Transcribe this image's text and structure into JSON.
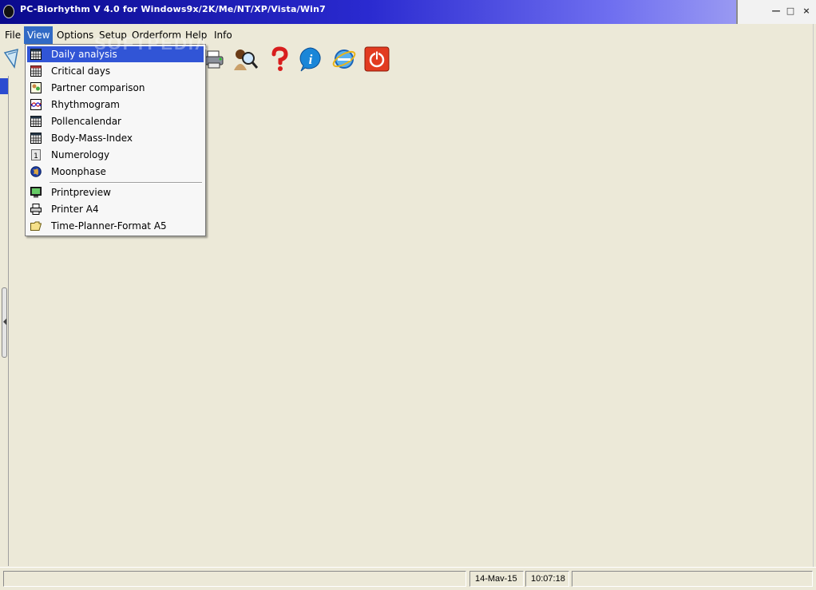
{
  "window": {
    "title": "PC-Biorhythm V 4.0 for Windows9x/2K/Me/NT/XP/Vista/Win7",
    "minimize_glyph": "□",
    "maximize_glyph": "▣",
    "close_glyph": "×"
  },
  "menubar": {
    "items": [
      {
        "label": "File"
      },
      {
        "label": "View"
      },
      {
        "label": "Options"
      },
      {
        "label": "Setup"
      },
      {
        "label": "Orderform"
      },
      {
        "label": "Help"
      },
      {
        "label": "Info"
      }
    ],
    "active": "View"
  },
  "toolbar": {
    "icons": [
      "pen-icon",
      "printer-icon",
      "search-person-icon",
      "help-icon",
      "info-icon",
      "internet-explorer-icon",
      "power-icon"
    ]
  },
  "view_menu": {
    "items": [
      {
        "label": "Daily analysis",
        "icon": "calendar-grid-icon",
        "highlighted": true
      },
      {
        "label": "Critical days",
        "icon": "calendar-grid-icon"
      },
      {
        "label": "Partner comparison",
        "icon": "partner-icon"
      },
      {
        "label": "Rhythmogram",
        "icon": "chart-icon"
      },
      {
        "label": "Pollencalendar",
        "icon": "calendar-grid-icon"
      },
      {
        "label": "Body-Mass-Index",
        "icon": "calendar-grid-icon"
      },
      {
        "label": "Numerology",
        "icon": "number-icon"
      },
      {
        "label": "Moonphase",
        "icon": "globe-icon"
      },
      {
        "label": "Printpreview",
        "icon": "monitor-icon"
      },
      {
        "label": "Printer A4",
        "icon": "printer-icon"
      },
      {
        "label": "Time-Planner-Format A5",
        "icon": "folder-icon"
      }
    ]
  },
  "statusbar": {
    "message": "",
    "date": "14-Mav-15",
    "time": "10:07:18"
  },
  "watermark": "SOFTPEDIA",
  "colors": {
    "menu_highlight": "#3155d6",
    "title_start": "#0a0a8c",
    "title_end": "#b4b4f4",
    "window_bg": "#ece9d8"
  }
}
